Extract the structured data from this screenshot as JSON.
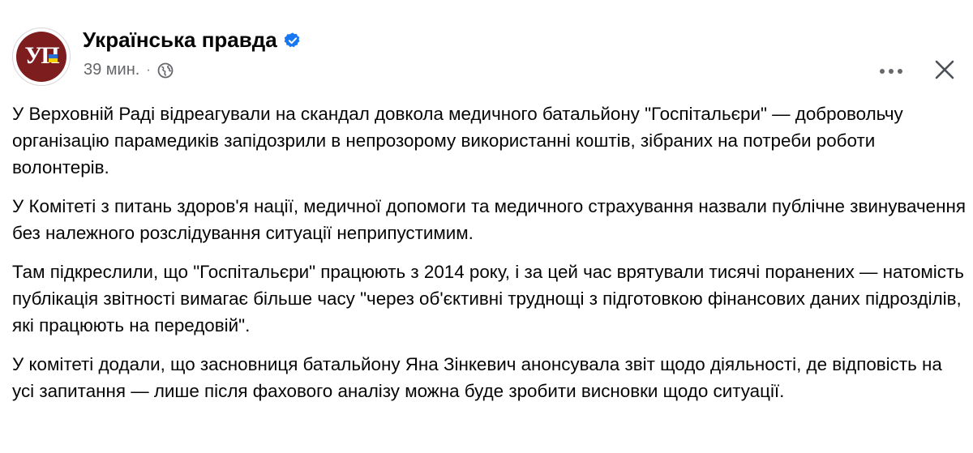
{
  "post": {
    "page_name": "Українська правда",
    "avatar_logo_text": "УП",
    "verified": true,
    "timestamp": "39 мин.",
    "separator": "·",
    "privacy_icon": "globe-icon",
    "more_icon": "more-horizontal-icon",
    "close_icon": "close-icon",
    "paragraphs": [
      "У Верховній Раді відреагували на скандал довкола медичного батальйону \"Госпітальєри\" — добровольчу організацію парамедиків запідозрили в непрозорому використанні коштів, зібраних на потреби роботи волонтерів.",
      "У Комітеті з питань здоров'я нації, медичної допомоги та медичного страхування назвали публічне звинувачення без належного розслідування ситуації неприпустимим.",
      "Там підкреслили, що \"Госпітальєри\" працюють з 2014 року, і за цей час врятували тисячі поранених — натомість публікація звітності вимагає більше часу \"через об'єктивні труднощі з підготовкою фінансових даних підрозділів, які працюють на передовій\".",
      "У комітеті додали, що засновниця батальйону Яна Зінкевич анонсувала звіт щодо діяльності, де відповість на усі запитання — лише після фахового аналізу можна буде зробити висновки щодо ситуації."
    ]
  },
  "colors": {
    "avatar_bg": "#7d1d1d",
    "verified_blue": "#1877f2",
    "meta_gray": "#65676b",
    "text": "#050505"
  }
}
